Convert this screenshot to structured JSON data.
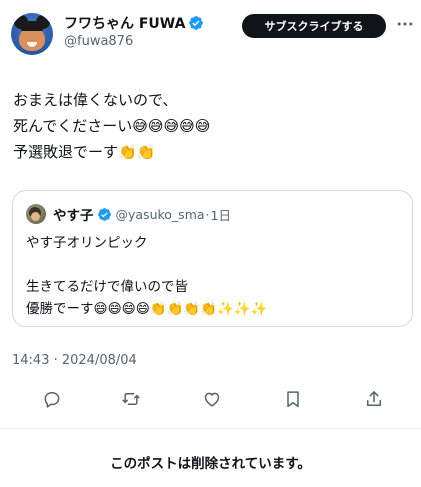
{
  "author": {
    "display_name": "フワちゃん FUWA",
    "handle": "@fuwa876",
    "verified": true
  },
  "header": {
    "subscribe_label": "サブスクライブする"
  },
  "tweet": {
    "lines": [
      "おまえは偉くないので、",
      "死んでくださーい😅😅😅😅😅",
      "予選敗退でーす👏👏"
    ]
  },
  "quote": {
    "display_name": "やす子",
    "handle": "@yasuko_sma",
    "separator": "·",
    "time": "1日",
    "lines": [
      "やす子オリンピック",
      "",
      "生きてるだけで偉いので皆",
      "優勝でーす😄😄😄😄👏👏👏👏✨✨✨"
    ]
  },
  "timestamp": "14:43 · 2024/08/04",
  "actions": [
    {
      "icon": "reply-icon"
    },
    {
      "icon": "retweet-icon"
    },
    {
      "icon": "like-icon"
    },
    {
      "icon": "bookmark-icon"
    },
    {
      "icon": "share-icon"
    }
  ],
  "notice": "このポストは削除されています。",
  "colors": {
    "verified": "#1d9bf0",
    "secondary_text": "#536471",
    "button_bg": "#0f1419"
  }
}
